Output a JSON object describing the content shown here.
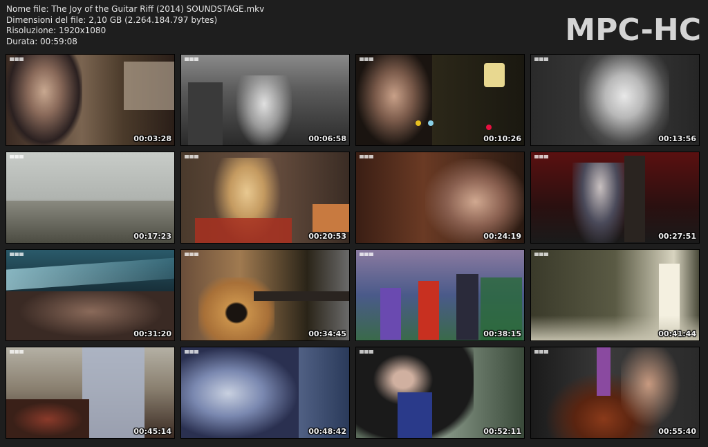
{
  "info": {
    "file_name": "Nome file: The Joy of the Guitar Riff (2014) SOUNDSTAGE.mkv",
    "file_size": "Dimensioni del file: 2,10 GB (2.264.184.797 bytes)",
    "resolution": "Risoluzione: 1920x1080",
    "duration": "Durata: 00:59:08"
  },
  "logo": "MPC-HC",
  "thumbnails": [
    {
      "timestamp": "00:03:28"
    },
    {
      "timestamp": "00:06:58"
    },
    {
      "timestamp": "00:10:26"
    },
    {
      "timestamp": "00:13:56"
    },
    {
      "timestamp": "00:17:23"
    },
    {
      "timestamp": "00:20:53"
    },
    {
      "timestamp": "00:24:19"
    },
    {
      "timestamp": "00:27:51"
    },
    {
      "timestamp": "00:31:20"
    },
    {
      "timestamp": "00:34:45"
    },
    {
      "timestamp": "00:38:15"
    },
    {
      "timestamp": "00:41:44"
    },
    {
      "timestamp": "00:45:14"
    },
    {
      "timestamp": "00:48:42"
    },
    {
      "timestamp": "00:52:11"
    },
    {
      "timestamp": "00:55:40"
    }
  ]
}
